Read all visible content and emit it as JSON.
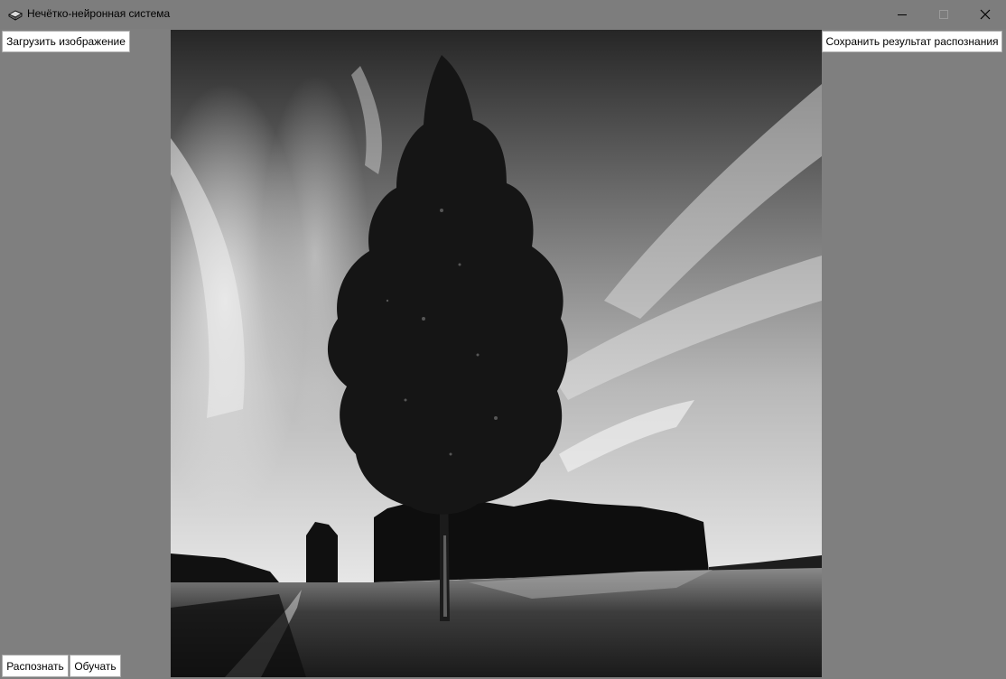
{
  "window": {
    "title": "Нечётко-нейронная система",
    "icon": "book-stack-icon",
    "controls": [
      "minimize-icon",
      "maximize-icon",
      "close-icon"
    ]
  },
  "buttons": {
    "load_image": "Загрузить изображение",
    "save_result": "Сохранить результат распознания",
    "recognize": "Распознать",
    "train": "Обучать"
  },
  "image": {
    "description_icon": "photo-canvas",
    "mode": "grayscale"
  },
  "colors": {
    "background": "#7f7f7f",
    "button_bg": "#ffffff",
    "button_border": "#adadad"
  }
}
